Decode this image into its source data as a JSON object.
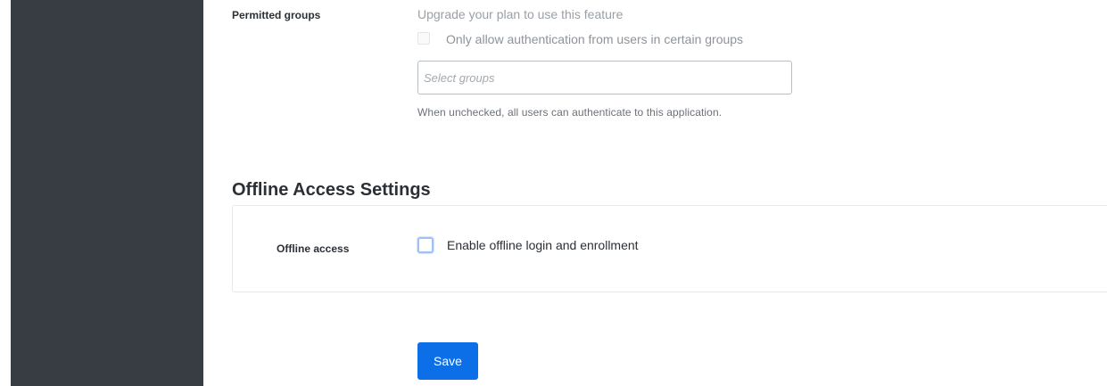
{
  "permitted_groups": {
    "label": "Permitted groups",
    "upgrade_notice": "Upgrade your plan to use this feature",
    "checkbox_label": "Only allow authentication from users in certain groups",
    "checked": false,
    "disabled": true,
    "select_placeholder": "Select groups",
    "help_text": "When unchecked, all users can authenticate to this application."
  },
  "offline_access": {
    "heading": "Offline Access Settings",
    "label": "Offline access",
    "checkbox_label": "Enable offline login and enrollment",
    "checked": false
  },
  "actions": {
    "save_label": "Save"
  },
  "colors": {
    "sidebar": "#383d44",
    "primary": "#0d6fe8"
  }
}
